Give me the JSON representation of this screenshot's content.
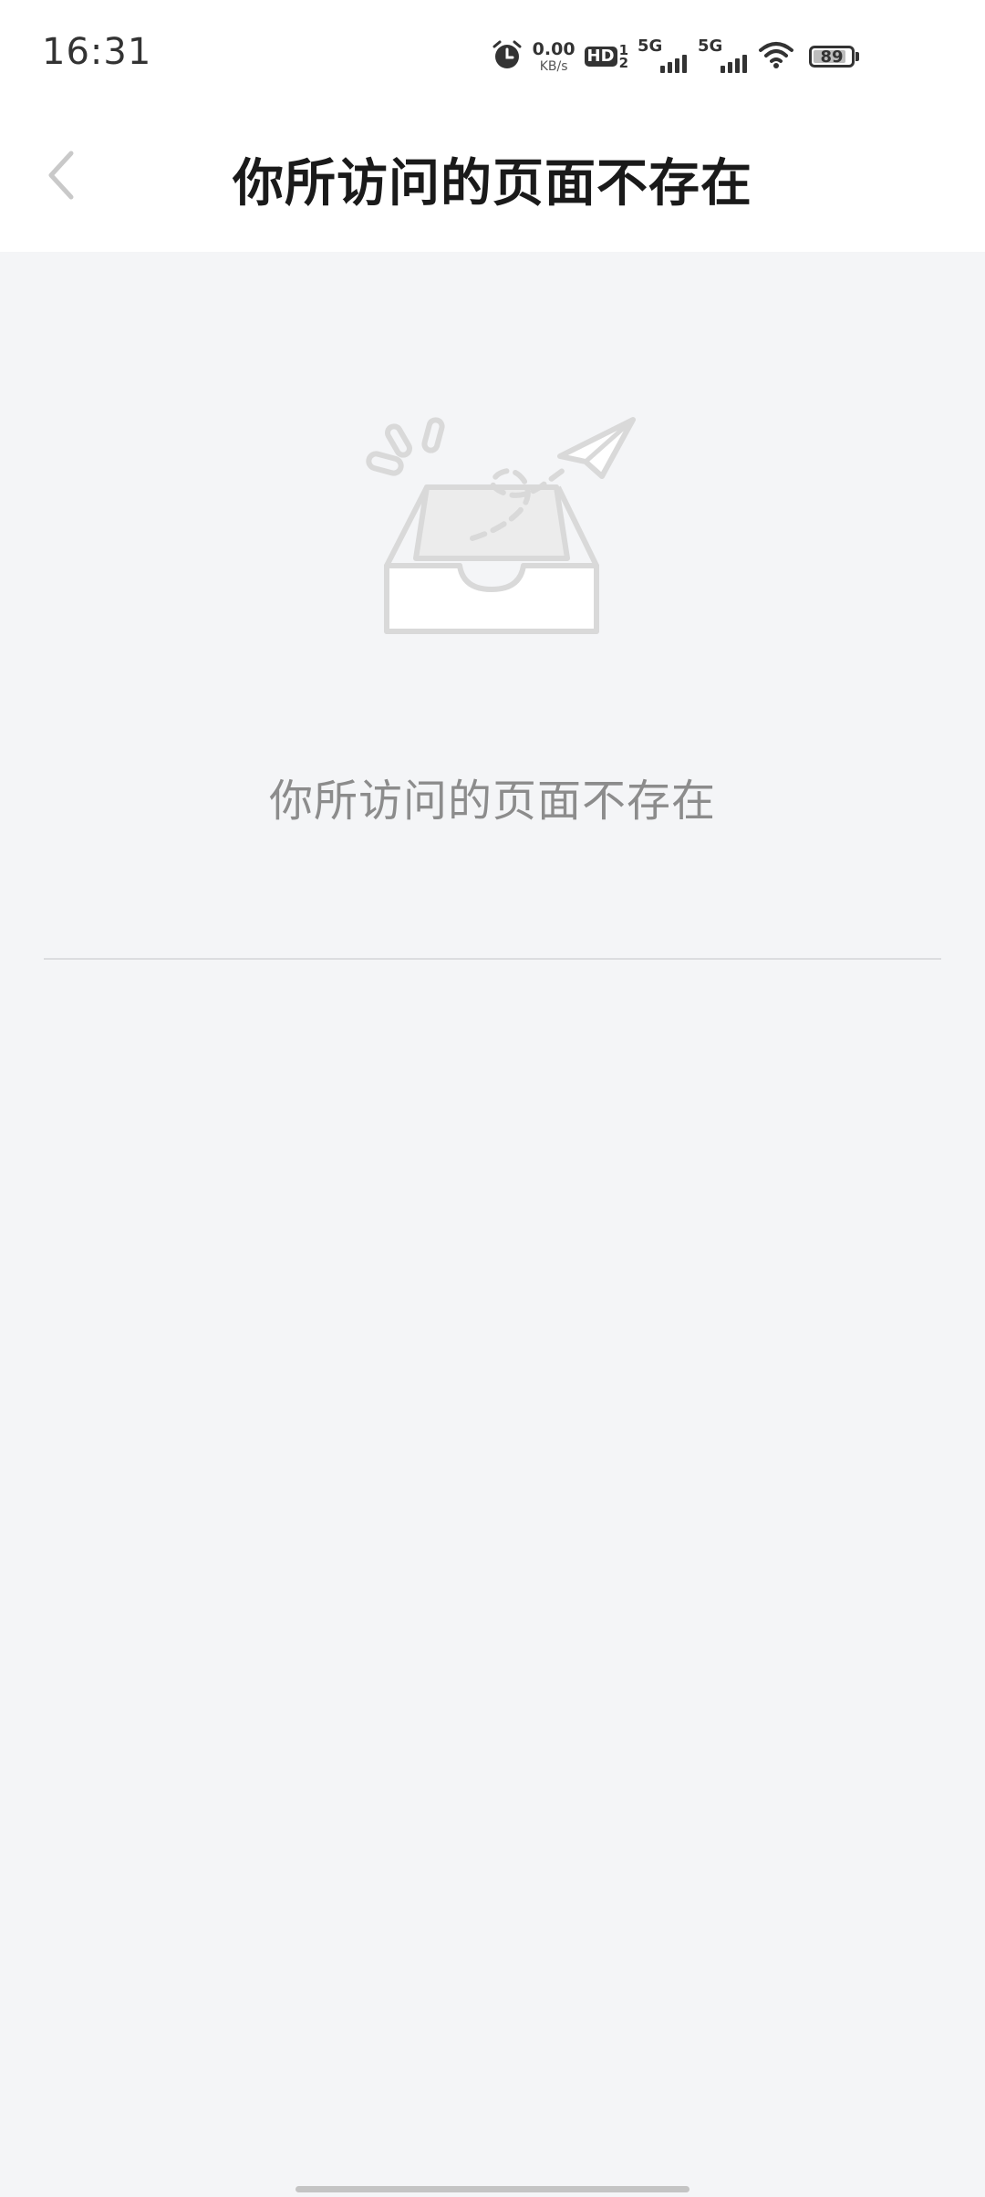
{
  "status_bar": {
    "time": "16:31",
    "net_speed_value": "0.00",
    "net_speed_unit": "KB/s",
    "hd_label": "HD",
    "hd_sim_top": "1",
    "hd_sim_bottom": "2",
    "sim1_network": "5G",
    "sim2_network": "5G",
    "battery_level": "89",
    "icons": [
      "alarm-icon",
      "hd-voice-icon",
      "signal-icon",
      "signal-icon",
      "wifi-icon",
      "battery-icon"
    ]
  },
  "nav": {
    "title": "你所访问的页面不存在",
    "back_icon": "chevron-left-icon"
  },
  "empty_state": {
    "icon": "empty-tray-paper-plane-icon",
    "message": "你所访问的页面不存在"
  },
  "colors": {
    "page_background": "#f4f5f7",
    "header_background": "#ffffff",
    "title_text": "#1a1a1a",
    "message_text": "#8c8c8c",
    "illustration_stroke": "#d9d9d9"
  }
}
